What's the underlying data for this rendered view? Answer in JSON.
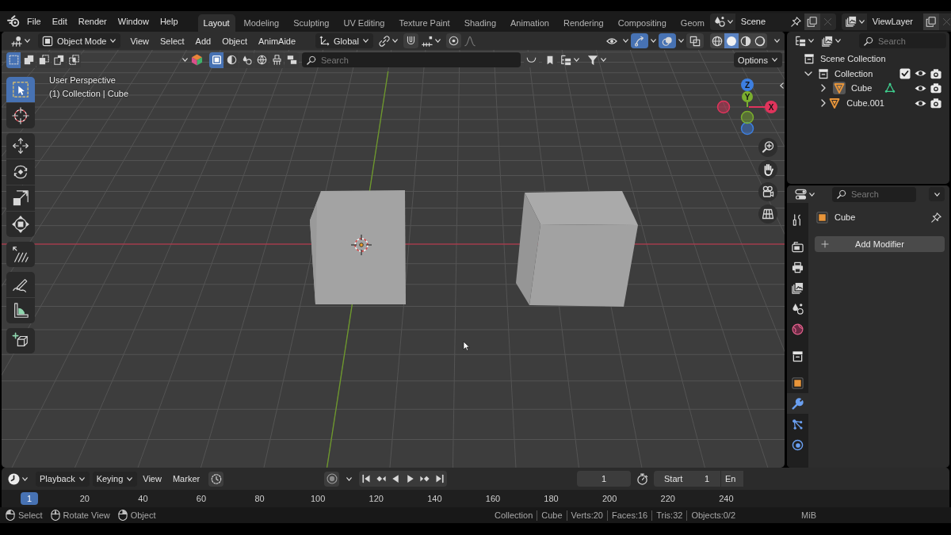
{
  "topbar": {
    "menus": [
      "File",
      "Edit",
      "Render",
      "Window",
      "Help"
    ],
    "workspaces": [
      {
        "label": "Layout",
        "selected": true
      },
      {
        "label": "Modeling",
        "selected": false
      },
      {
        "label": "Sculpting",
        "selected": false
      },
      {
        "label": "UV Editing",
        "selected": false
      },
      {
        "label": "Texture Paint",
        "selected": false
      },
      {
        "label": "Shading",
        "selected": false
      },
      {
        "label": "Animation",
        "selected": false
      },
      {
        "label": "Rendering",
        "selected": false
      },
      {
        "label": "Compositing",
        "selected": false
      },
      {
        "label": "Geom",
        "selected": false
      }
    ],
    "scene": "Scene",
    "view_layer": "ViewLayer"
  },
  "viewport_header": {
    "mode": "Object Mode",
    "menus": [
      "View",
      "Select",
      "Add",
      "Object",
      "AnimAide"
    ],
    "orientation": "Global",
    "toggles": [
      {
        "kind": "visibility",
        "on": false
      },
      {
        "kind": "gizmo",
        "on": true
      },
      {
        "kind": "overlay",
        "on": true
      },
      {
        "kind": "xray",
        "on": false
      }
    ],
    "shading_modes": [
      {
        "kind": "wireframe",
        "selected": false
      },
      {
        "kind": "solid",
        "selected": true
      },
      {
        "kind": "material",
        "selected": false
      },
      {
        "kind": "rendered",
        "selected": false
      }
    ]
  },
  "tool_header": {
    "select_modes": [
      {
        "kind": "new",
        "selected": true
      },
      {
        "kind": "extend",
        "selected": false
      },
      {
        "kind": "subtract",
        "selected": false
      },
      {
        "kind": "invert",
        "selected": false
      },
      {
        "kind": "intersect",
        "selected": false
      }
    ],
    "filters": [
      {
        "kind": "object",
        "selected": true
      },
      {
        "kind": "material",
        "selected": false
      },
      {
        "kind": "physics",
        "selected": false
      },
      {
        "kind": "world",
        "selected": false
      },
      {
        "kind": "brush",
        "selected": false
      },
      {
        "kind": "layers",
        "selected": false
      }
    ],
    "search": {
      "placeholder": "Search"
    },
    "options": "Options"
  },
  "toolbar": [
    {
      "tools": [
        {
          "kind": "select",
          "selected": true
        },
        {
          "kind": "cursor",
          "selected": false
        }
      ]
    },
    {
      "tools": [
        {
          "kind": "move",
          "selected": false
        },
        {
          "kind": "rotate",
          "selected": false
        },
        {
          "kind": "scale",
          "selected": false
        },
        {
          "kind": "transform",
          "selected": false
        }
      ]
    },
    {
      "tools": [
        {
          "kind": "shear",
          "selected": false
        }
      ]
    },
    {
      "tools": [
        {
          "kind": "annotate",
          "selected": false
        },
        {
          "kind": "measure",
          "selected": false
        }
      ]
    },
    {
      "tools": [
        {
          "kind": "addcube",
          "selected": false
        }
      ]
    }
  ],
  "viewport": {
    "view_name": "User Perspective",
    "context": "(1) Collection | Cube",
    "gizmo_axes": [
      {
        "label": "Z",
        "color": "#3d7fe0"
      },
      {
        "label": "Y",
        "color": "#7aae2e"
      },
      {
        "label": "X",
        "color": "#e0345c"
      }
    ]
  },
  "outliner": {
    "search": {
      "placeholder": "Search"
    },
    "tree": [
      {
        "label": "Scene Collection",
        "kind": "root",
        "children": [
          {
            "label": "Collection",
            "kind": "collection",
            "expanded": true,
            "checked": true,
            "children": [
              {
                "label": "Cube",
                "kind": "object",
                "expanded": false,
                "active": true,
                "mesh_data": true
              },
              {
                "label": "Cube.001",
                "kind": "object",
                "expanded": false,
                "active": false,
                "mesh_data": false
              }
            ]
          }
        ]
      }
    ]
  },
  "properties": {
    "search": {
      "placeholder": "Search"
    },
    "tab_groups": [
      {
        "tabs": [
          {
            "kind": "tool",
            "selected": false
          }
        ]
      },
      {
        "tabs": [
          {
            "kind": "render",
            "selected": false
          },
          {
            "kind": "output",
            "selected": false
          },
          {
            "kind": "viewlayer",
            "selected": false
          },
          {
            "kind": "scene",
            "selected": false
          },
          {
            "kind": "world",
            "selected": false
          }
        ]
      },
      {
        "tabs": [
          {
            "kind": "collection",
            "selected": false
          }
        ]
      },
      {
        "tabs": [
          {
            "kind": "object",
            "selected": false
          },
          {
            "kind": "modifier",
            "selected": true
          },
          {
            "kind": "particles",
            "selected": false
          },
          {
            "kind": "physics",
            "selected": false
          }
        ]
      }
    ],
    "object_name": "Cube",
    "add_button": "Add Modifier"
  },
  "timeline": {
    "menus": [
      {
        "label": "Playback",
        "kind": "dropdown"
      },
      {
        "label": "Keying",
        "kind": "dropdown"
      },
      {
        "label": "View",
        "kind": "menu"
      },
      {
        "label": "Marker",
        "kind": "menu"
      }
    ],
    "current_frame": "1",
    "start_label": "Start",
    "start_value": "1",
    "end_label": "En",
    "playhead": "1",
    "ruler_labels": [
      "20",
      "40",
      "60",
      "80",
      "100",
      "120",
      "140",
      "160",
      "180",
      "200",
      "220",
      "240"
    ]
  },
  "status_bar": {
    "hints": [
      {
        "label": "Select",
        "kind": "left"
      },
      {
        "label": "Rotate View",
        "kind": "middle"
      },
      {
        "label": "Object",
        "kind": "right"
      }
    ],
    "stats": [
      "Collection",
      "Cube",
      "Verts:20",
      "Faces:16",
      "Tris:32",
      "Objects:0/2"
    ],
    "memory": "MiB"
  }
}
